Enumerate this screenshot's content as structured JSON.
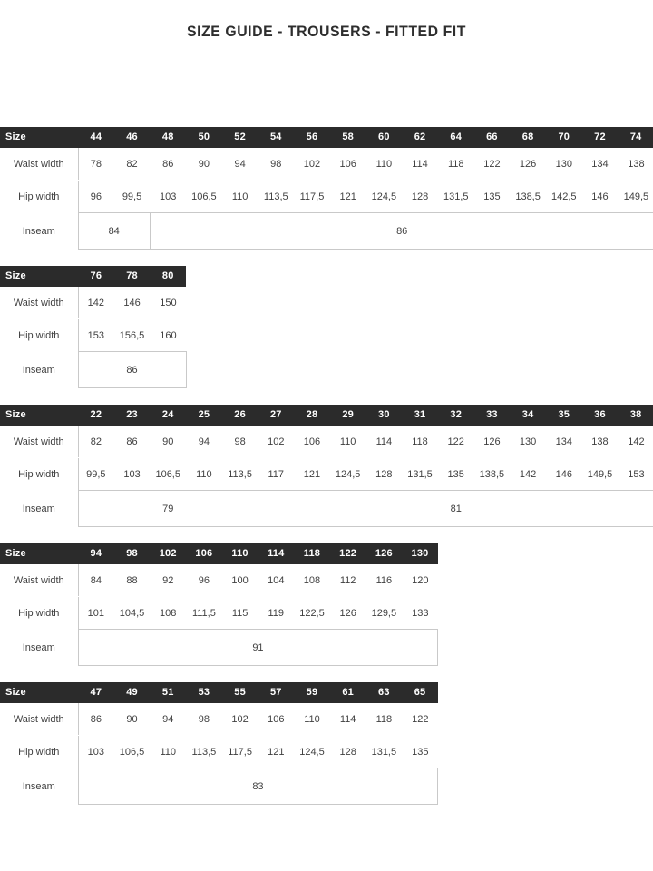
{
  "title": "SIZE GUIDE - TROUSERS - FITTED FIT",
  "row_labels": {
    "size": "Size",
    "waist": "Waist width",
    "hip": "Hip width",
    "inseam": "Inseam"
  },
  "colors": {
    "header_background": "#2b2b2b",
    "header_text": "#ffffff",
    "border": "#c9c9c9",
    "page_background": "#ffffff",
    "text": "#404040"
  },
  "tables": [
    {
      "id": "table-eu-sizes-44-74",
      "sizes": [
        "44",
        "46",
        "48",
        "50",
        "52",
        "54",
        "56",
        "58",
        "60",
        "62",
        "64",
        "66",
        "68",
        "70",
        "72",
        "74"
      ],
      "waist": [
        "78",
        "82",
        "86",
        "90",
        "94",
        "98",
        "102",
        "106",
        "110",
        "114",
        "118",
        "122",
        "126",
        "130",
        "134",
        "138"
      ],
      "hip": [
        "96",
        "99,5",
        "103",
        "106,5",
        "110",
        "113,5",
        "117,5",
        "121",
        "124,5",
        "128",
        "131,5",
        "135",
        "138,5",
        "142,5",
        "146",
        "149,5"
      ],
      "inseam_segments": [
        {
          "value": "84",
          "span": 2
        },
        {
          "value": "86",
          "span": 14
        }
      ]
    },
    {
      "id": "table-eu-sizes-76-80",
      "sizes": [
        "76",
        "78",
        "80"
      ],
      "waist": [
        "142",
        "146",
        "150"
      ],
      "hip": [
        "153",
        "156,5",
        "160"
      ],
      "inseam_segments": [
        {
          "value": "86",
          "span": 3
        }
      ]
    },
    {
      "id": "table-us-sizes-22-38",
      "sizes": [
        "22",
        "23",
        "24",
        "25",
        "26",
        "27",
        "28",
        "29",
        "30",
        "31",
        "32",
        "33",
        "34",
        "35",
        "36",
        "38"
      ],
      "waist": [
        "82",
        "86",
        "90",
        "94",
        "98",
        "102",
        "106",
        "110",
        "114",
        "118",
        "122",
        "126",
        "130",
        "134",
        "138",
        "142"
      ],
      "hip": [
        "99,5",
        "103",
        "106,5",
        "110",
        "113,5",
        "117",
        "121",
        "124,5",
        "128",
        "131,5",
        "135",
        "138,5",
        "142",
        "146",
        "149,5",
        "153"
      ],
      "inseam_segments": [
        {
          "value": "79",
          "span": 5
        },
        {
          "value": "81",
          "span": 11
        }
      ]
    },
    {
      "id": "table-sizes-94-130",
      "sizes": [
        "94",
        "98",
        "102",
        "106",
        "110",
        "114",
        "118",
        "122",
        "126",
        "130"
      ],
      "waist": [
        "84",
        "88",
        "92",
        "96",
        "100",
        "104",
        "108",
        "112",
        "116",
        "120"
      ],
      "hip": [
        "101",
        "104,5",
        "108",
        "111,5",
        "115",
        "119",
        "122,5",
        "126",
        "129,5",
        "133"
      ],
      "inseam_segments": [
        {
          "value": "91",
          "span": 10
        }
      ]
    },
    {
      "id": "table-sizes-47-65",
      "sizes": [
        "47",
        "49",
        "51",
        "53",
        "55",
        "57",
        "59",
        "61",
        "63",
        "65"
      ],
      "waist": [
        "86",
        "90",
        "94",
        "98",
        "102",
        "106",
        "110",
        "114",
        "118",
        "122"
      ],
      "hip": [
        "103",
        "106,5",
        "110",
        "113,5",
        "117,5",
        "121",
        "124,5",
        "128",
        "131,5",
        "135"
      ],
      "inseam_segments": [
        {
          "value": "83",
          "span": 10
        }
      ]
    }
  ]
}
